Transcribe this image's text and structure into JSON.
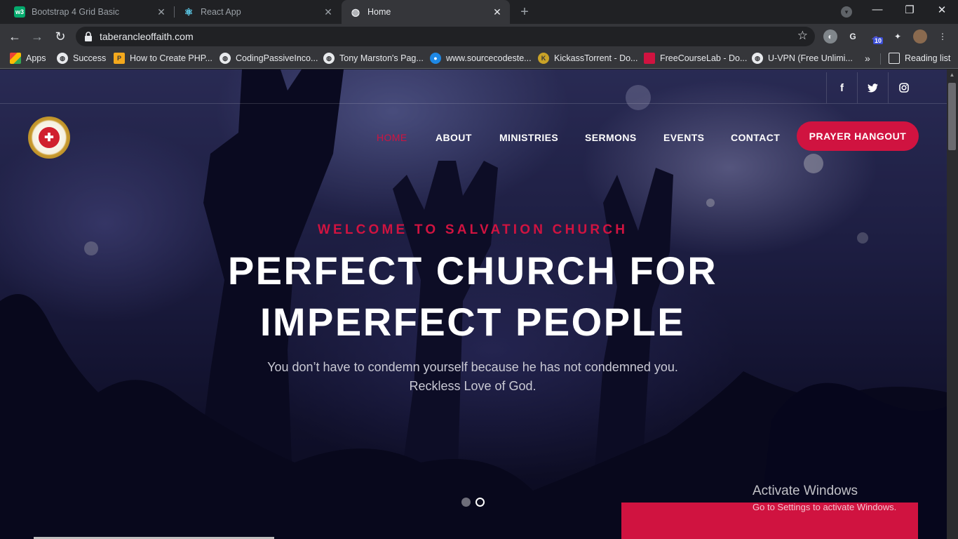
{
  "browser": {
    "tabs": [
      {
        "title": "Bootstrap 4 Grid Basic",
        "icon": "w3schools-icon",
        "active": false
      },
      {
        "title": "React App",
        "icon": "react-icon",
        "active": false
      },
      {
        "title": "Home",
        "icon": "globe-icon",
        "active": true
      }
    ],
    "new_tab": "+",
    "address": "taberancleoffaith.com",
    "extension_badge": "10",
    "bookmarks": [
      {
        "label": "Apps",
        "icon": "apps-grid-icon"
      },
      {
        "label": "Success",
        "icon": "globe-icon"
      },
      {
        "label": "How to Create PHP...",
        "icon": "p-icon"
      },
      {
        "label": "CodingPassiveInco...",
        "icon": "globe-icon"
      },
      {
        "label": "Tony Marston's Pag...",
        "icon": "globe-icon"
      },
      {
        "label": "www.sourcecodeste...",
        "icon": "drop-icon"
      },
      {
        "label": "KickassTorrent - Do...",
        "icon": "k-icon"
      },
      {
        "label": "FreeCourseLab - Do...",
        "icon": "bookmark-icon"
      },
      {
        "label": "U-VPN (Free Unlimi...",
        "icon": "globe-icon"
      }
    ],
    "reading_list": "Reading list"
  },
  "site": {
    "social": [
      "f",
      "t",
      "ig"
    ],
    "nav": {
      "home": "HOME",
      "about": "ABOUT",
      "ministries": "MINISTRIES",
      "sermons": "SERMONS",
      "events": "EVENTS",
      "contact": "CONTACT"
    },
    "cta": "PRAYER HANGOUT",
    "hero": {
      "kicker": "WELCOME TO SALVATION CHURCH",
      "headline_line1": "PERFECT CHURCH FOR",
      "headline_line2": "IMPERFECT PEOPLE",
      "sub_line1": "You don’t have to condemn yourself because he has not condemned you.",
      "sub_line2": "Reckless Love of God."
    },
    "slides": {
      "count": 2,
      "active": 2
    }
  },
  "system": {
    "watermark_title": "Activate Windows",
    "watermark_sub": "Go to Settings to activate Windows."
  },
  "colors": {
    "accent": "#d01340",
    "chrome_dark": "#202124",
    "chrome_toolbar": "#35363a"
  }
}
